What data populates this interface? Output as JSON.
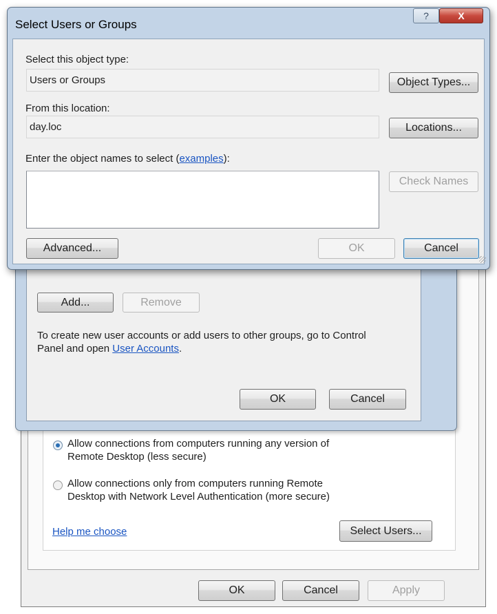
{
  "dialog": {
    "title": "Select Users or Groups",
    "help_glyph": "?",
    "close_glyph": "X",
    "object_type_label": "Select this object type:",
    "object_type_value": "Users or Groups",
    "object_types_button": "Object Types...",
    "location_label": "From this location:",
    "location_value": "day.loc",
    "locations_button": "Locations...",
    "names_label_prefix": "Enter the object names to select (",
    "names_label_link": "examples",
    "names_label_suffix": "):",
    "names_value": "",
    "check_names_button": "Check Names",
    "advanced_button": "Advanced...",
    "ok_button": "OK",
    "cancel_button": "Cancel"
  },
  "middle_dialog": {
    "add_button": "Add...",
    "remove_button": "Remove",
    "info_text_line1": "To create new user accounts or add users to other groups, go to Control",
    "info_text_line2_prefix": "Panel and open ",
    "info_text_link": "User Accounts",
    "info_text_line2_suffix": ".",
    "ok_button": "OK",
    "cancel_button": "Cancel"
  },
  "back_dialog": {
    "radio_any_line1": "Allow connections from computers running any version of",
    "radio_any_line2": "Remote Desktop (less secure)",
    "radio_nla_line1": "Allow connections only from computers running Remote",
    "radio_nla_line2": "Desktop with Network Level Authentication (more secure)",
    "help_link": "Help me choose",
    "select_users_button": "Select Users...",
    "ok_button": "OK",
    "cancel_button": "Cancel",
    "apply_button": "Apply"
  },
  "colors": {
    "link": "#1a55c2",
    "window_frame": "#c3d4e7",
    "close_button": "#c84a3e",
    "radio_selected": "#2a6fb5"
  }
}
